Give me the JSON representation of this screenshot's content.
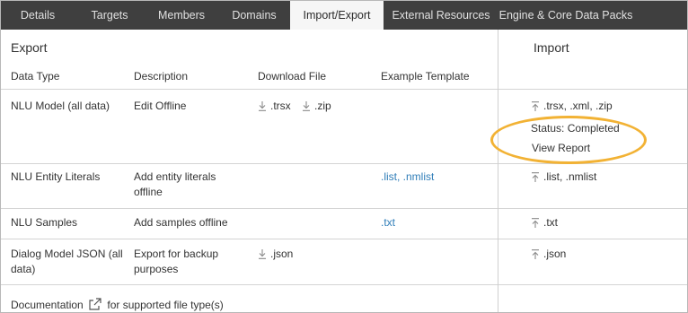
{
  "tabs": [
    {
      "label": "Details"
    },
    {
      "label": "Targets"
    },
    {
      "label": "Members"
    },
    {
      "label": "Domains"
    },
    {
      "label": "Import/Export"
    },
    {
      "label": "External Resources"
    },
    {
      "label": "Engine & Core Data Packs"
    }
  ],
  "export": {
    "title": "Export",
    "columns": {
      "data_type": "Data Type",
      "description": "Description",
      "download_file": "Download File",
      "example_template": "Example Template"
    },
    "rows": [
      {
        "data_type": "NLU Model (all data)",
        "description": "Edit Offline",
        "downloads": [
          ".trsx",
          ".zip"
        ],
        "template": ""
      },
      {
        "data_type": "NLU Entity Literals",
        "description": "Add entity literals offline",
        "downloads": [],
        "template": ".list, .nmlist"
      },
      {
        "data_type": "NLU Samples",
        "description": "Add samples offline",
        "downloads": [],
        "template": ".txt"
      },
      {
        "data_type": "Dialog Model JSON (all data)",
        "description": "Export for backup purposes",
        "downloads": [
          ".json"
        ],
        "template": ""
      }
    ],
    "footer": {
      "documentation_link": "Documentation",
      "suffix": "for supported file type(s)"
    }
  },
  "import": {
    "title": "Import",
    "rows": [
      {
        "upload": ".trsx, .xml, .zip",
        "status": "Status: Completed",
        "report_link": "View Report"
      },
      {
        "upload": ".list, .nmlist"
      },
      {
        "upload": ".txt"
      },
      {
        "upload": ".json"
      }
    ]
  },
  "colors": {
    "tab_bar": "#3f3f3f",
    "active_tab": "#f6f6f6",
    "link": "#2f7db8",
    "highlight_ring": "#f2b234"
  }
}
